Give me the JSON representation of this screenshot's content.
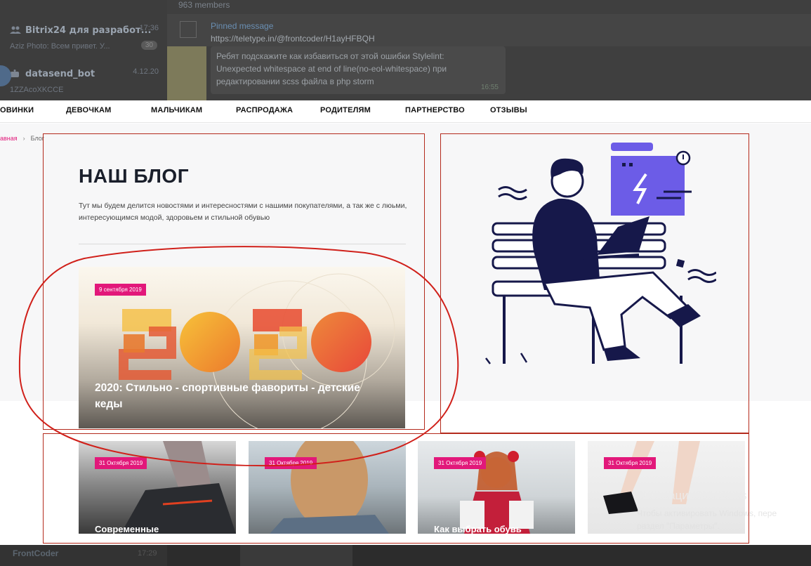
{
  "telegram": {
    "members": "963 members",
    "chats": [
      {
        "name": "Bitrix24 для разработ...",
        "time": "17:36",
        "preview": "Aziz Photo: Всем привет. У...",
        "badge": "30"
      },
      {
        "name": "datasend_bot",
        "time": "4.12.20",
        "preview": "1ZZAcoXKCCE",
        "badge": ""
      }
    ],
    "pinned_label": "Pinned message",
    "pinned_url": "https://teletype.in/@frontcoder/H1ayHFBQH",
    "message_lines": [
      "Ребят подскажите как избавиться от этой ошибки Stylelint:",
      "Unexpected whitespace at end of line(no-eol-whitespace) при",
      "редактировании scss файла в php storm"
    ],
    "message_time": "16:55",
    "bottom_chat": {
      "name": "FrontCoder",
      "time": "17:29"
    }
  },
  "nav": [
    "ОВИНКИ",
    "ДЕВОЧКАМ",
    "МАЛЬЧИКАМ",
    "РАСПРОДАЖА",
    "РОДИТЕЛЯМ",
    "ПАРТНЕРСТВО",
    "ОТЗЫВЫ"
  ],
  "breadcrumbs": {
    "home": "авная",
    "current": "Блог"
  },
  "blog": {
    "title": "НАШ БЛОГ",
    "description": "Тут мы будем делится новостями и интересностями с нашими покупателями, а так же с люьми, интересующимся модой, здоровьем и стильной обувью"
  },
  "feature": {
    "date": "9 сентября 2019",
    "art_text": "2020",
    "title": "2020: Стильно - спортивные фавориты - детские кеды"
  },
  "cards": [
    {
      "date": "31 Октября 2019",
      "title": "Современные"
    },
    {
      "date": "31 Октября 2019",
      "title": ""
    },
    {
      "date": "31 Октября 2019",
      "title": "Как выбрать обувь"
    },
    {
      "date": "31 Октября 2019",
      "title": ""
    }
  ],
  "windows_activation": {
    "title": "Активация Windows",
    "line1": "Чтобы активировать Windows, пере",
    "line2": "раздел \"Параметры\"."
  },
  "colors": {
    "accent": "#e2187a",
    "navy": "#16184a",
    "purple": "#6c5ce7",
    "annotation": "#b42a1c"
  }
}
